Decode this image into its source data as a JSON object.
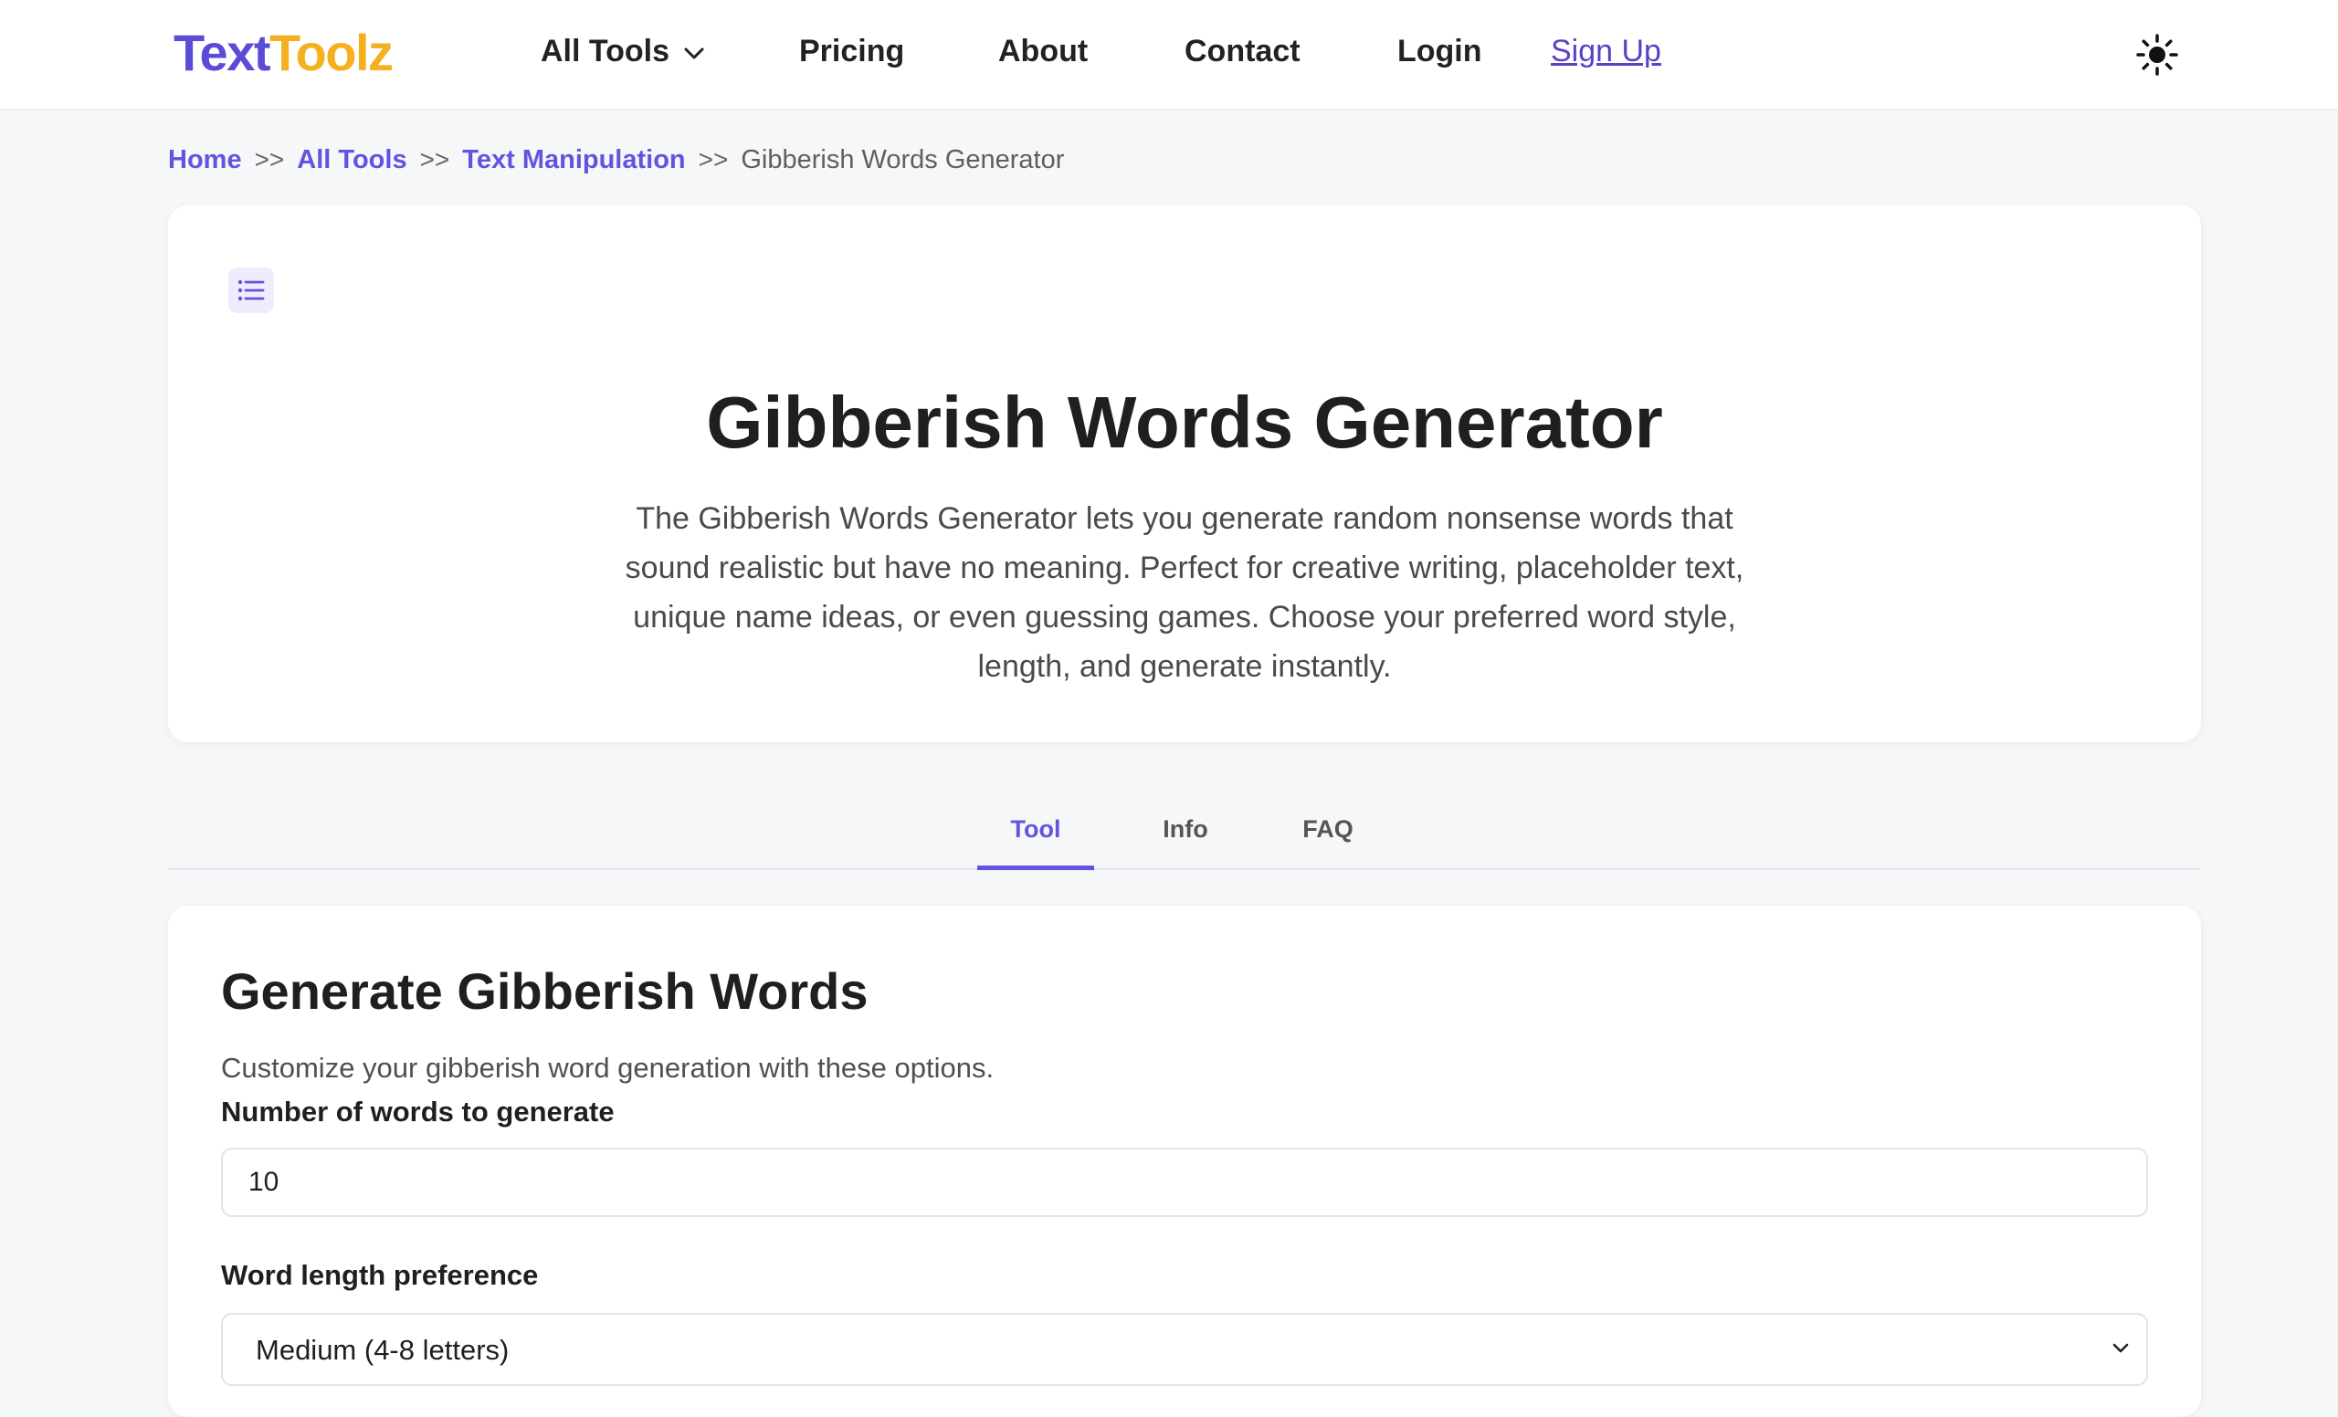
{
  "brand": {
    "part1": "Text",
    "part2": "Toolz"
  },
  "nav": {
    "all_tools": "All Tools",
    "pricing": "Pricing",
    "about": "About",
    "contact": "Contact",
    "login": "Login",
    "signup": "Sign Up"
  },
  "breadcrumb": {
    "home": "Home",
    "all_tools": "All Tools",
    "category": "Text Manipulation",
    "current": "Gibberish Words Generator",
    "separator": ">>"
  },
  "hero": {
    "title": "Gibberish Words Generator",
    "description": "The Gibberish Words Generator lets you generate random nonsense words that sound realistic but have no meaning. Perfect for creative writing, placeholder text, unique name ideas, or even guessing games. Choose your preferred word style, length, and generate instantly."
  },
  "tabs": [
    {
      "label": "Tool",
      "active": true
    },
    {
      "label": "Info",
      "active": false
    },
    {
      "label": "FAQ",
      "active": false
    }
  ],
  "form": {
    "title": "Generate Gibberish Words",
    "subtitle": "Customize your gibberish word generation with these options.",
    "count_label": "Number of words to generate",
    "count_value": "10",
    "length_label": "Word length preference",
    "length_value": "Medium (4-8 letters)"
  },
  "colors": {
    "accent": "#6453e0",
    "logo_primary": "#5b4bd6",
    "logo_secondary": "#f5b020",
    "background": "#f6f7f9"
  },
  "icons": {
    "dropdown": "chevron-down-icon",
    "theme": "sun-icon",
    "toc": "list-icon"
  }
}
